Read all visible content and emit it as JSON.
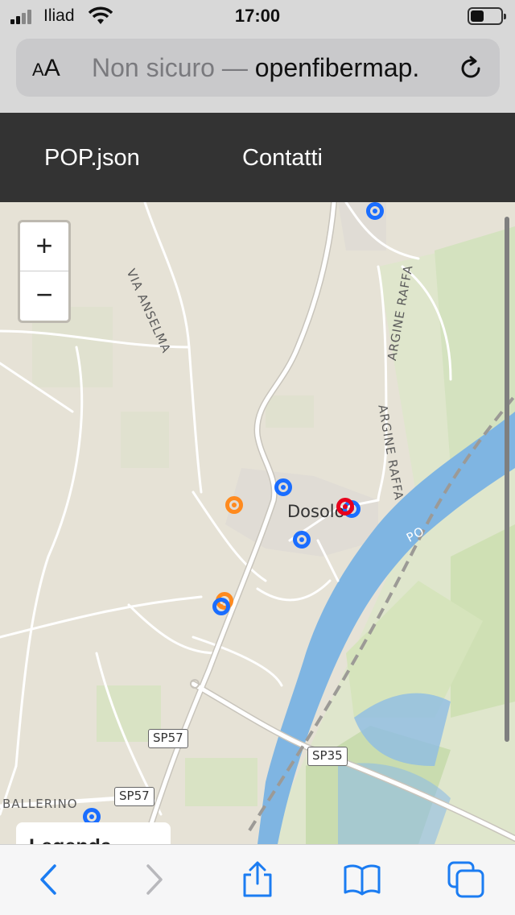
{
  "status": {
    "carrier": "Iliad",
    "time": "17:00"
  },
  "browser": {
    "text_size_label": "AA",
    "security_label": "Non sicuro —",
    "host": "openfibermap."
  },
  "nav": {
    "links": [
      "POP.json",
      "Contatti"
    ]
  },
  "map": {
    "zoom_in": "+",
    "zoom_out": "−",
    "roads": [
      "VIA ANSELMA",
      "ARGINE RAFFA",
      "ARGINE RAFFA",
      "BALLERINO"
    ],
    "town": "Dosolo",
    "river": "PO",
    "shields": [
      "SP57",
      "SP35",
      "SP57"
    ],
    "marker_colors": {
      "blue": "#1a6dff",
      "orange": "#ff8a1e",
      "red": "#e8001c"
    },
    "legend_title": "Legenda"
  },
  "toolbar": {
    "accent": "#1b7cf2"
  }
}
